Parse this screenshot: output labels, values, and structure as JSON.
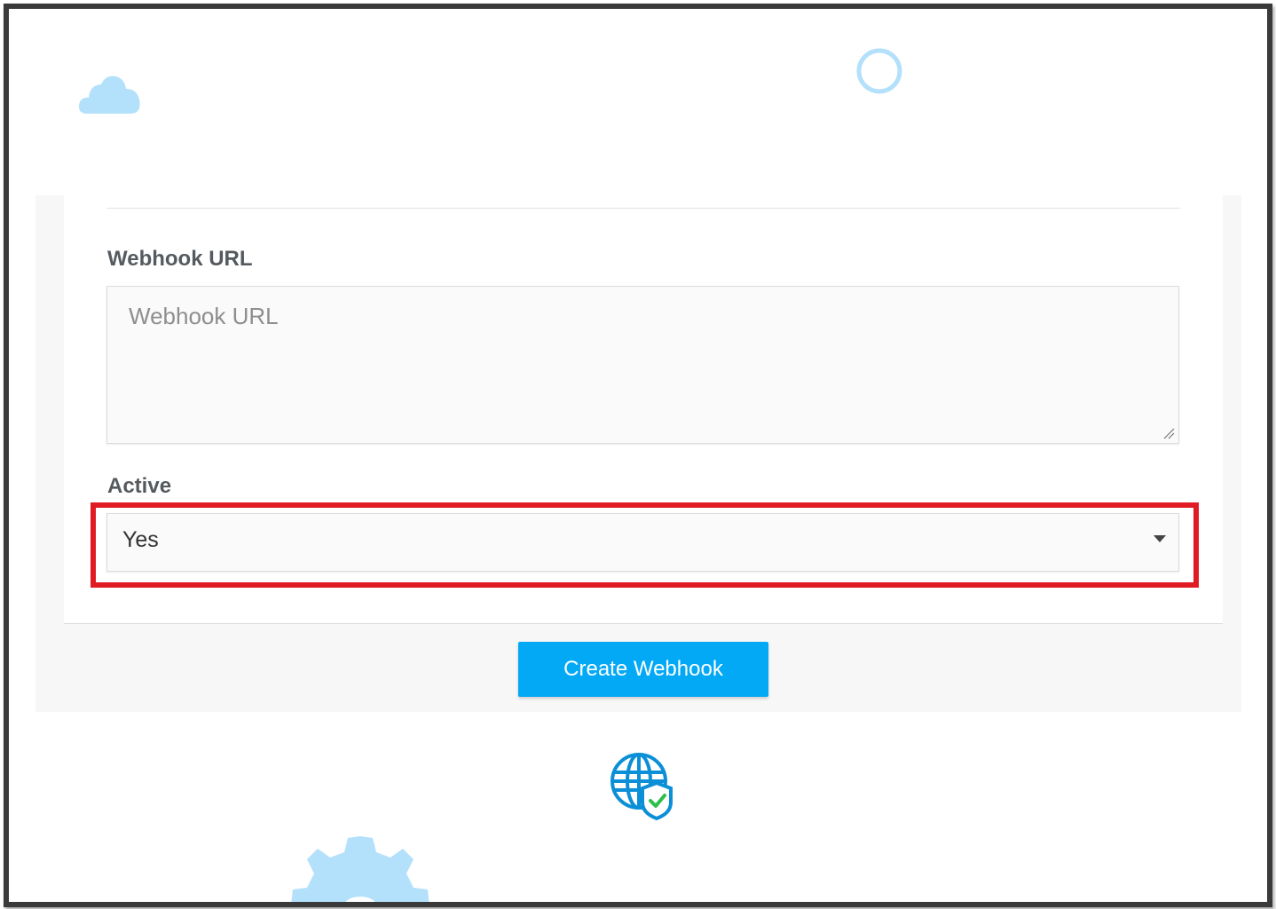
{
  "form": {
    "webhook_url": {
      "label": "Webhook URL",
      "value": "",
      "placeholder": "Webhook URL"
    },
    "active": {
      "label": "Active",
      "selected_value": "Yes"
    },
    "submit_label": "Create Webhook"
  },
  "colors": {
    "accent": "#04a9f5",
    "highlight": "#e01b24",
    "decoration": "#b3e0fb"
  },
  "icons": {
    "cloud": "cloud-icon",
    "ring": "circle-icon",
    "globe": "globe-shield-icon",
    "gear": "gear-icon",
    "caret": "caret-down-icon",
    "resize": "resize-handle-icon"
  }
}
